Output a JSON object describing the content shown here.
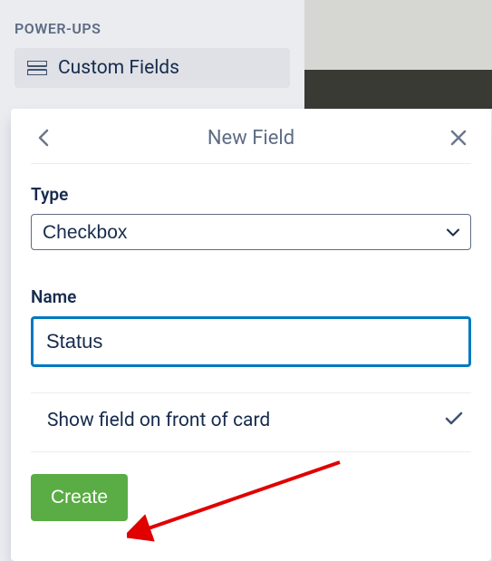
{
  "sidebar": {
    "heading": "POWER-UPS",
    "items": [
      {
        "label": "Custom Fields"
      }
    ]
  },
  "modal": {
    "title": "New Field",
    "type_label": "Type",
    "type_value": "Checkbox",
    "name_label": "Name",
    "name_value": "Status",
    "show_on_front_label": "Show field on front of card",
    "create_label": "Create"
  }
}
